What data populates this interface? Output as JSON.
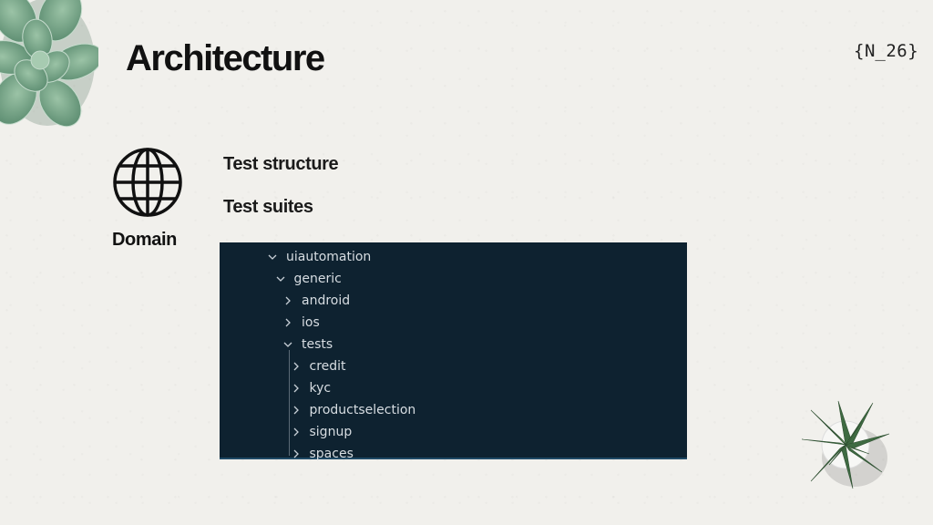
{
  "slide": {
    "title": "Architecture",
    "logo_text": "{N̲26}",
    "section_label": "Domain",
    "section_icon": "globe-icon",
    "items": [
      "Test structure",
      "Test suites"
    ]
  },
  "file_tree": {
    "colors": {
      "background": "#0e2230",
      "text": "#d7dde2"
    },
    "nodes": [
      {
        "label": "uiautomation",
        "state": "expanded",
        "depth": 0
      },
      {
        "label": "generic",
        "state": "expanded",
        "depth": 1
      },
      {
        "label": "android",
        "state": "collapsed",
        "depth": 2
      },
      {
        "label": "ios",
        "state": "collapsed",
        "depth": 2
      },
      {
        "label": "tests",
        "state": "expanded",
        "depth": 2
      },
      {
        "label": "credit",
        "state": "collapsed",
        "depth": 3
      },
      {
        "label": "kyc",
        "state": "collapsed",
        "depth": 3
      },
      {
        "label": "productselection",
        "state": "collapsed",
        "depth": 3
      },
      {
        "label": "signup",
        "state": "collapsed",
        "depth": 3
      },
      {
        "label": "spaces",
        "state": "collapsed",
        "depth": 3
      }
    ]
  }
}
